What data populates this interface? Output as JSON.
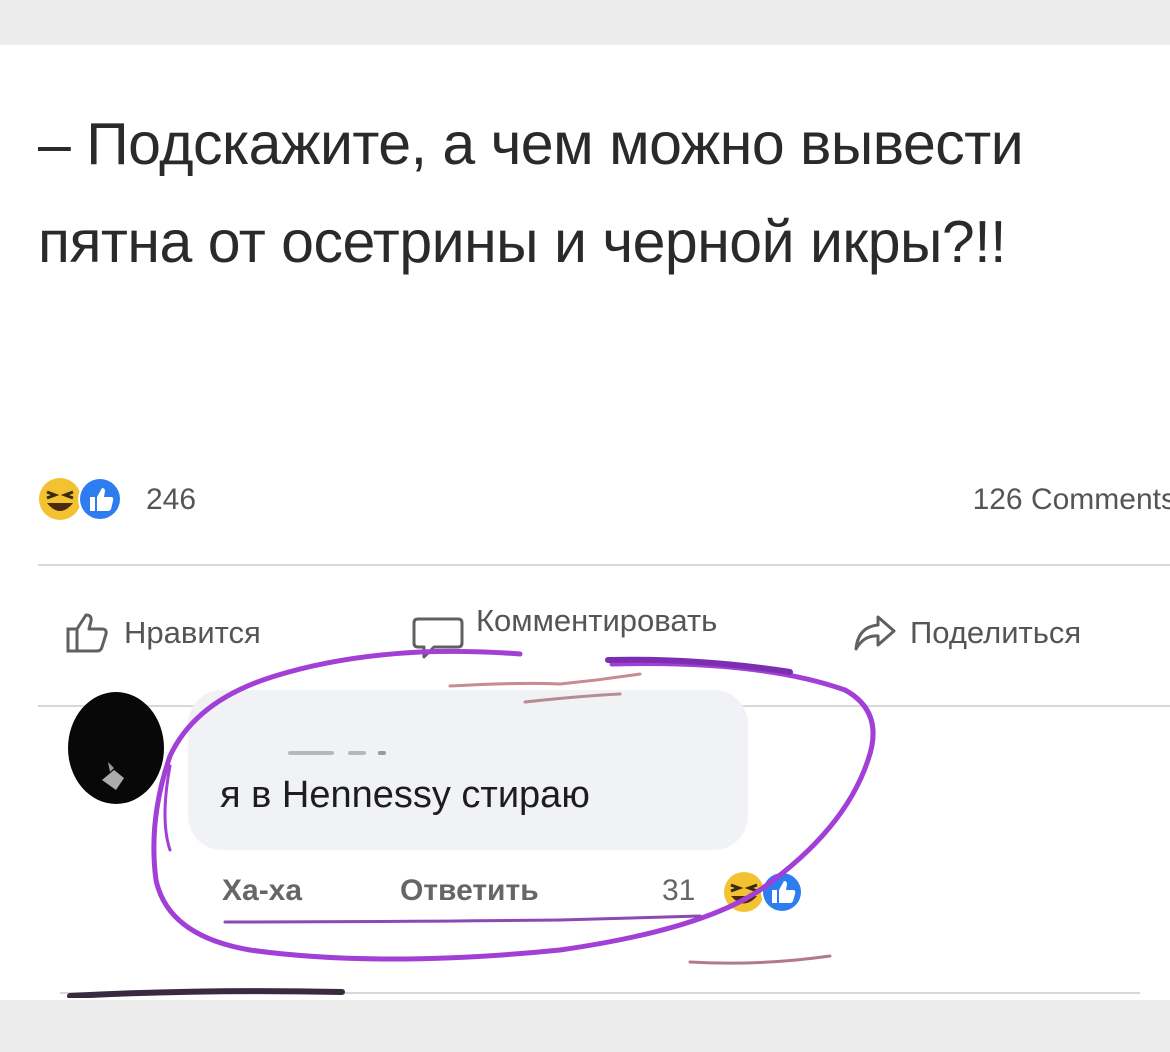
{
  "post": {
    "text": "– Подскажите, а чем можно вывести пятна от осетрины и черной икры?!!"
  },
  "stats": {
    "reaction_count": "246",
    "comments_label": "126 Comments",
    "reaction_icons": [
      "haha-emoji-icon",
      "like-icon"
    ]
  },
  "actions": {
    "like_label": "Нравится",
    "comment_label": "Комментировать",
    "share_label": "Поделиться"
  },
  "comment": {
    "text": "я в Hennessy стираю",
    "haha_label": "Ха-ха",
    "reply_label": "Ответить",
    "reaction_count": "31"
  },
  "colors": {
    "annotation": "#a23fd6",
    "like_blue": "#2d7cf0",
    "emoji_yellow": "#f2c230"
  }
}
